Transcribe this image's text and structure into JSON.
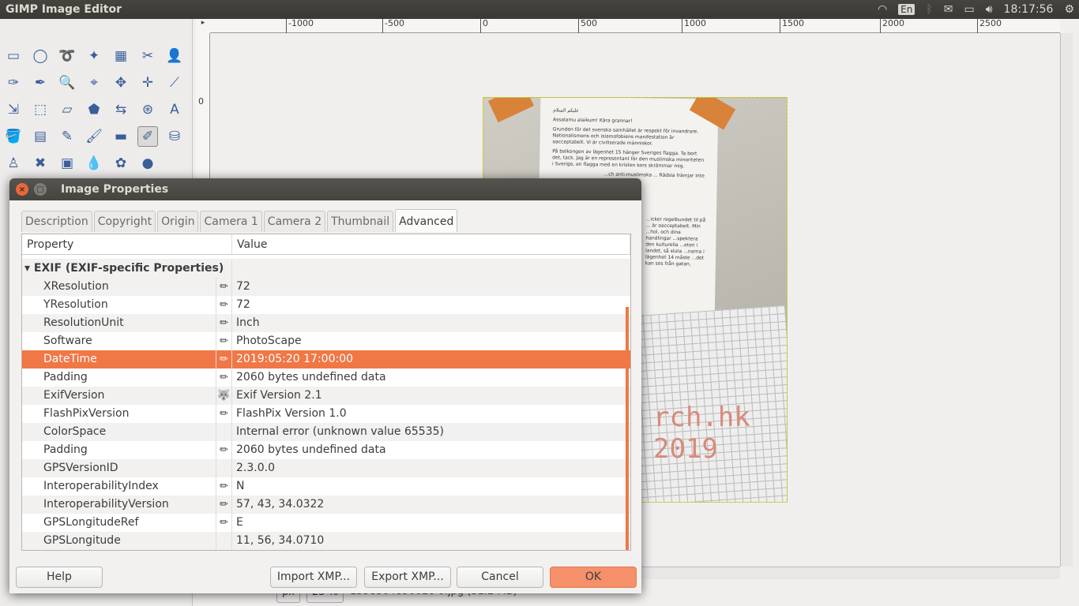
{
  "topbar": {
    "title": "GIMP Image Editor",
    "keyboard": "En",
    "clock": "18:17:56"
  },
  "ruler": {
    "top": [
      "-1000",
      "-500",
      "0",
      "500",
      "1000",
      "1500",
      "2000",
      "2500"
    ],
    "left": [
      "0"
    ]
  },
  "photo_text": [
    "عليكم السلام",
    "Assalamu alaikum! Kära grannar!",
    "Grunden för det svenska samhället är respekt för invandrare. Nationalismens och islamofobiens manifestation är oacceptabelt. Vi är civiliserade människor.",
    "På balkongen av lägenhet 15 hänger Sveriges flagga. Ta bort det, tack. Jag är en representant för den muslimska minoriteten i Sverige, en flagga med en kristen kors skrämmar mig.",
    "...ch anti-muslimska ... Rädsla främjar inte",
    "...icker regelbundet til på ... är oacceptabelt. Min ...hol, och dina handlingar ...spektera den kulturella ...eten i landet, så sluta ...narna i lägenhet 14 måste ...det kan ses från gatan,",
    "rch.hk",
    "2019"
  ],
  "status": {
    "unit": "px",
    "zoom": "25 %",
    "file": "1558504850026 0.jpg (31.2 MB)"
  },
  "dialog": {
    "title": "Image Properties",
    "tabs": [
      "Description",
      "Copyright",
      "Origin",
      "Camera 1",
      "Camera 2",
      "Thumbnail",
      "Advanced"
    ],
    "active_tab": "Advanced",
    "columns": [
      "Property",
      "Value"
    ],
    "group": "EXIF (EXIF-specific Properties)",
    "rows": [
      {
        "property": "XResolution",
        "icon": "pencil",
        "value": "72"
      },
      {
        "property": "YResolution",
        "icon": "pencil",
        "value": "72"
      },
      {
        "property": "ResolutionUnit",
        "icon": "pencil",
        "value": "Inch"
      },
      {
        "property": "Software",
        "icon": "pencil",
        "value": "PhotoScape"
      },
      {
        "property": "DateTime",
        "icon": "pencil",
        "value": "2019:05:20 17:00:00",
        "selected": true
      },
      {
        "property": "Padding",
        "icon": "pencil",
        "value": "2060 bytes undefined data"
      },
      {
        "property": "ExifVersion",
        "icon": "gimp",
        "value": "Exif Version 2.1"
      },
      {
        "property": "FlashPixVersion",
        "icon": "pencil",
        "value": "FlashPix Version 1.0"
      },
      {
        "property": "ColorSpace",
        "icon": "",
        "value": "Internal error (unknown value 65535)"
      },
      {
        "property": "Padding",
        "icon": "pencil",
        "value": "2060 bytes undefined data"
      },
      {
        "property": "GPSVersionID",
        "icon": "",
        "value": "2.3.0.0"
      },
      {
        "property": "InteroperabilityIndex",
        "icon": "pencil",
        "value": "N"
      },
      {
        "property": "InteroperabilityVersion",
        "icon": "pencil",
        "value": "57, 43, 34.0322"
      },
      {
        "property": "GPSLongitudeRef",
        "icon": "pencil",
        "value": "E"
      },
      {
        "property": "GPSLongitude",
        "icon": "",
        "value": "11, 56, 34.0710"
      }
    ],
    "buttons": {
      "help": "Help",
      "import": "Import XMP...",
      "export": "Export XMP...",
      "cancel": "Cancel",
      "ok": "OK"
    }
  },
  "colors": {
    "accent": "#f07746",
    "ok": "#f5906a"
  }
}
